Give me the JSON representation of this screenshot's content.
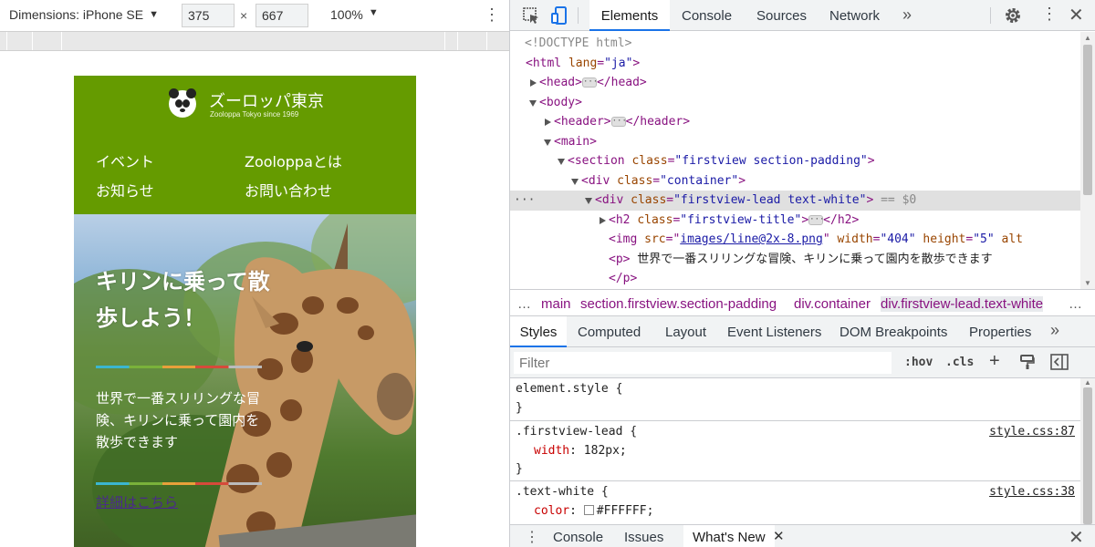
{
  "device_toolbar": {
    "dimensions_label": "Dimensions: iPhone SE",
    "width": "375",
    "height": "667",
    "times": "×",
    "zoom": "100%"
  },
  "site": {
    "name": "ズーロッパ東京",
    "tagline": "Zooloppa Tokyo since 1969",
    "nav": [
      "イベント",
      "Zooloppaとは",
      "お知らせ",
      "お問い合わせ"
    ],
    "hero_title": "キリンに乗って散歩しよう！",
    "hero_text": "世界で一番スリリングな冒険、キリンに乗って園内を散歩できます",
    "hero_link": "詳細はこちら",
    "colors": {
      "header_bg": "#659b00",
      "text": "#ffffff"
    }
  },
  "devtools": {
    "tabs": [
      "Elements",
      "Console",
      "Sources",
      "Network"
    ],
    "active_tab": "Elements",
    "dom": {
      "doctype": "<!DOCTYPE html>",
      "html_open": "<html ",
      "html_attr": "lang",
      "html_val": "\"ja\"",
      "head": "<head>",
      "head_close": "</head>",
      "body": "<body>",
      "header": "<header>",
      "header_close": "</header>",
      "main": "<main>",
      "section_open": "<section ",
      "section_attr": "class",
      "section_val": "\"firstview section-padding\"",
      "div1_open": "<div ",
      "div1_attr": "class",
      "div1_val": "\"container\"",
      "div2_open": "<div ",
      "div2_attr": "class",
      "div2_val": "\"firstview-lead text-white\"",
      "div2_eq": " == $0",
      "h2_open": "<h2 ",
      "h2_attr": "class",
      "h2_val": "\"firstview-title\"",
      "h2_close": "</h2>",
      "img_open": "<img ",
      "img_src_attr": "src",
      "img_src_val": "images/line@2x-8.png",
      "img_w_attr": "width",
      "img_w_val": "\"404\"",
      "img_h_attr": "height",
      "img_h_val": "\"5\"",
      "img_alt": "alt",
      "p_open": "<p>",
      "p_text": " 世界で一番スリリングな冒険、キリンに乗って園内を散歩できます",
      "p_close": "</p>"
    },
    "breadcrumbs": [
      "main",
      "section.firstview.section-padding",
      "div.container",
      "div.firstview-lead.text-white"
    ],
    "styles_tabs": [
      "Styles",
      "Computed",
      "Layout",
      "Event Listeners",
      "DOM Breakpoints",
      "Properties"
    ],
    "filter_placeholder": "Filter",
    "hov": ":hov",
    "cls": ".cls",
    "rules": [
      {
        "selector": "element.style {",
        "close": "}"
      },
      {
        "selector": ".firstview-lead {",
        "prop": "width",
        "value": "182px;",
        "source": "style.css:87",
        "close": "}"
      },
      {
        "selector": ".text-white {",
        "prop": "color",
        "value": "#FFFFFF;",
        "source": "style.css:38"
      }
    ],
    "drawer_tabs": [
      "Console",
      "Issues",
      "What's New"
    ]
  }
}
